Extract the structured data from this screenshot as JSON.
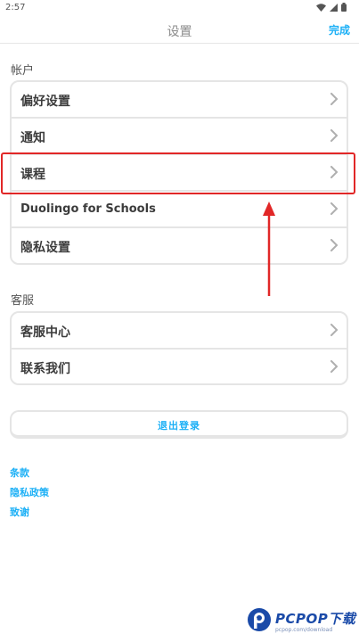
{
  "status_bar": {
    "time": "2:57"
  },
  "nav": {
    "title": "设置",
    "done_label": "完成"
  },
  "account": {
    "section_label": "帐户",
    "items": [
      {
        "label": "偏好设置"
      },
      {
        "label": "通知"
      },
      {
        "label": "课程"
      },
      {
        "label": "Duolingo for Schools"
      },
      {
        "label": "隐私设置"
      }
    ]
  },
  "support": {
    "section_label": "客服",
    "items": [
      {
        "label": "客服中心"
      },
      {
        "label": "联系我们"
      }
    ]
  },
  "logout_label": "退出登录",
  "links": [
    "条款",
    "隐私政策",
    "致谢"
  ],
  "watermark": {
    "text": "PCPOP下载",
    "subtitle": "pcpop.com/download"
  },
  "colors": {
    "accent": "#1cb0f6",
    "annotation": "#e12727",
    "border": "#e5e5e5"
  }
}
